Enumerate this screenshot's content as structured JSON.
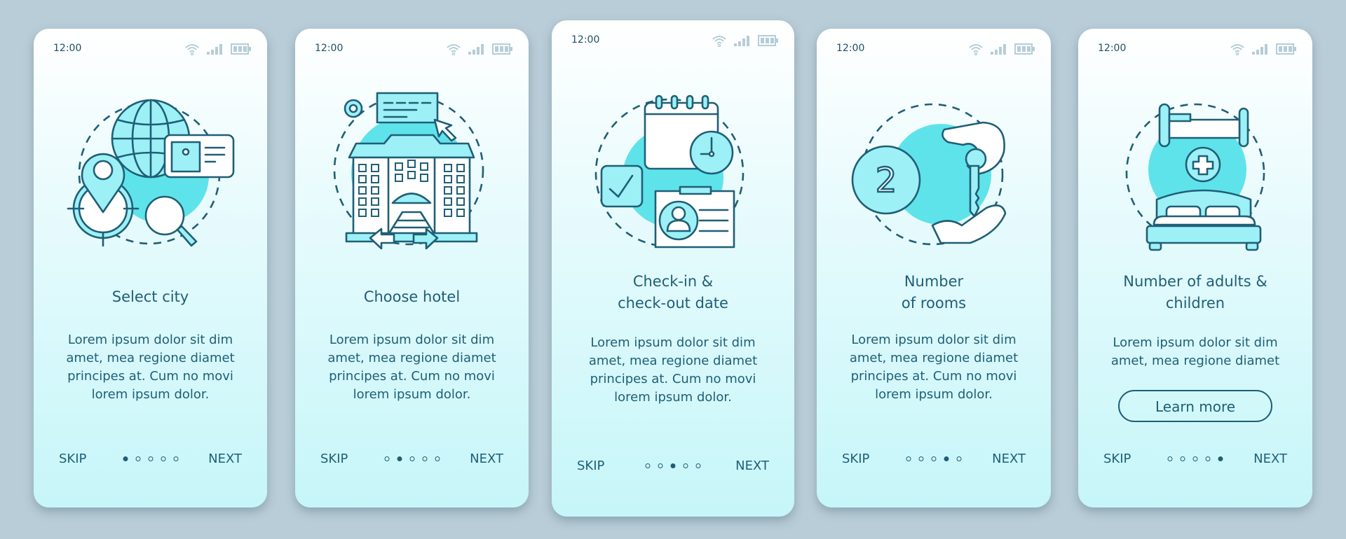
{
  "status_bar": {
    "time": "12:00",
    "icons": [
      "wifi-icon",
      "signal-icon",
      "battery-icon"
    ]
  },
  "colors": {
    "background": "#b8cdd7",
    "accent": "#5fe3ea",
    "text": "#1f5f76"
  },
  "screens": [
    {
      "title_lines": [
        "Select city"
      ],
      "body_lines": [
        "Lorem ipsum dolor sit dim",
        "amet, mea regione diamet",
        "principes at. Cum no movi",
        "lorem ipsum dolor."
      ],
      "illustration": "city-selection-illustration",
      "skip": "SKIP",
      "next": "NEXT",
      "active_step": 1,
      "total_steps": 5
    },
    {
      "title_lines": [
        "Choose hotel"
      ],
      "body_lines": [
        "Lorem ipsum dolor sit dim",
        "amet, mea regione diamet",
        "principes at. Cum no movi",
        "lorem ipsum dolor."
      ],
      "illustration": "hotel-building-illustration",
      "skip": "SKIP",
      "next": "NEXT",
      "active_step": 2,
      "total_steps": 5
    },
    {
      "title_lines": [
        "Check-in &",
        "check-out date"
      ],
      "body_lines": [
        "Lorem ipsum dolor sit dim",
        "amet, mea regione diamet",
        "principes at. Cum no movi",
        "lorem ipsum dolor."
      ],
      "illustration": "calendar-checkin-illustration",
      "skip": "SKIP",
      "next": "NEXT",
      "active_step": 3,
      "total_steps": 5
    },
    {
      "title_lines": [
        "Number",
        "of rooms"
      ],
      "body_lines": [
        "Lorem ipsum dolor sit dim",
        "amet, mea regione diamet",
        "principes at. Cum no movi",
        "lorem ipsum dolor."
      ],
      "illustration": "room-key-illustration",
      "badge_number": "2",
      "skip": "SKIP",
      "next": "NEXT",
      "active_step": 4,
      "total_steps": 5
    },
    {
      "title_lines": [
        "Number of adults &",
        "children"
      ],
      "body_lines": [
        "Lorem ipsum dolor sit dim",
        "amet, mea regione diamet"
      ],
      "illustration": "bed-illustration",
      "button": "Learn more",
      "skip": "SKIP",
      "next": "NEXT",
      "active_step": 5,
      "total_steps": 5
    }
  ]
}
